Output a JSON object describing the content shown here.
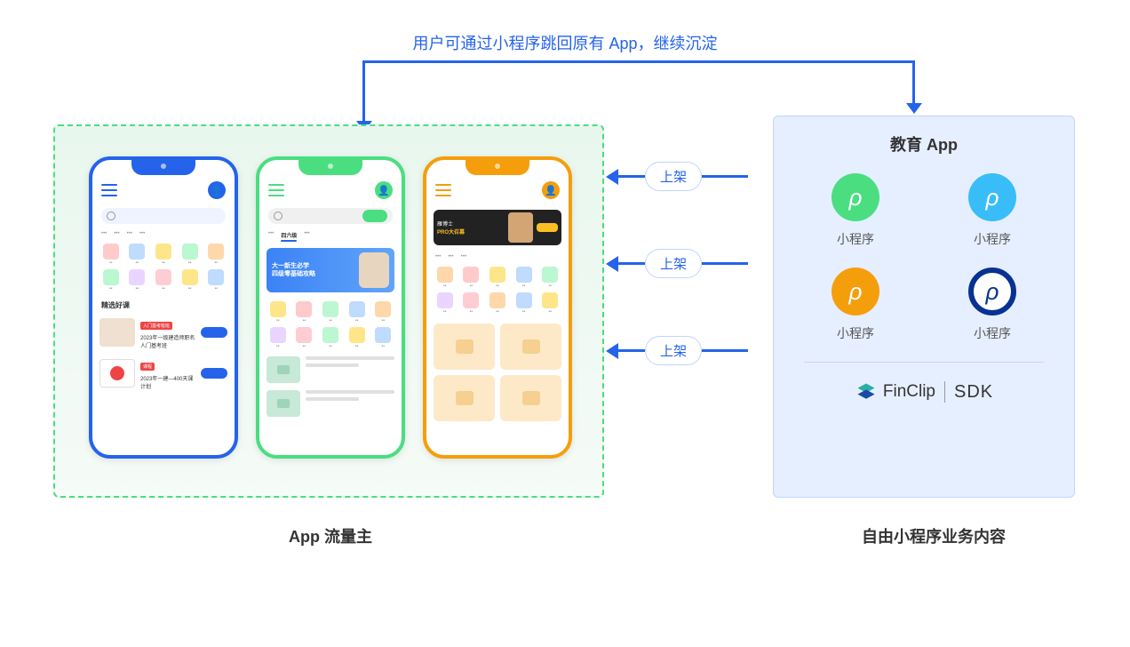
{
  "top_label": "用户可通过小程序跳回原有 App，继续沉淀",
  "left_panel_label": "App 流量主",
  "right_panel_label": "自由小程序业务内容",
  "right_panel": {
    "title": "教育 App",
    "items": [
      {
        "label": "小程序",
        "color": "g"
      },
      {
        "label": "小程序",
        "color": "lb"
      },
      {
        "label": "小程序",
        "color": "o"
      },
      {
        "label": "小程序",
        "color": "db"
      }
    ],
    "sdk_brand": "FinClip",
    "sdk_text": "SDK"
  },
  "arrows": [
    {
      "label": "上架"
    },
    {
      "label": "上架"
    },
    {
      "label": "上架"
    }
  ],
  "phones": {
    "blue": {
      "section_title": "精选好课",
      "cards": [
        {
          "badge": "入门基考班班",
          "title": "2023年一级建造师职名人门基考班",
          "sub": ""
        },
        {
          "badge": "课程",
          "title": "2023年一建—400天课计划",
          "sub": ""
        }
      ]
    },
    "green": {
      "tab_active": "四六级",
      "banner_line1": "大一新生必学",
      "banner_line2": "四级零基础攻略"
    },
    "orange": {
      "banner_line1": "雁博士",
      "banner_line2": "PRO大召募"
    }
  }
}
